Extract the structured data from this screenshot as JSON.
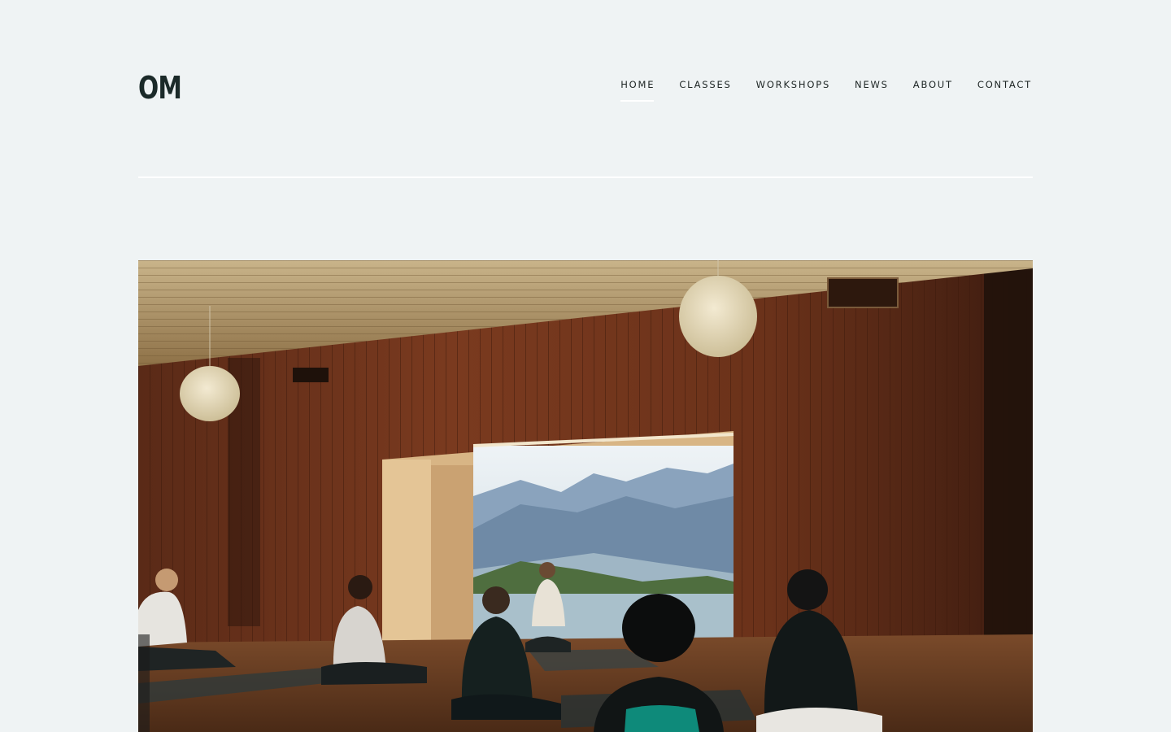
{
  "site": {
    "logo": "OM"
  },
  "nav": {
    "items": [
      {
        "label": "HOME",
        "active": true
      },
      {
        "label": "CLASSES",
        "active": false
      },
      {
        "label": "WORKSHOPS",
        "active": false
      },
      {
        "label": "NEWS",
        "active": false
      },
      {
        "label": "ABOUT",
        "active": false
      },
      {
        "label": "CONTACT",
        "active": false
      }
    ]
  },
  "hero": {
    "image_subject": "yoga class in a wooden studio with mountain lake view"
  },
  "colors": {
    "background": "#eff3f4",
    "text": "#1d2a2a",
    "divider": "#ffffff"
  }
}
